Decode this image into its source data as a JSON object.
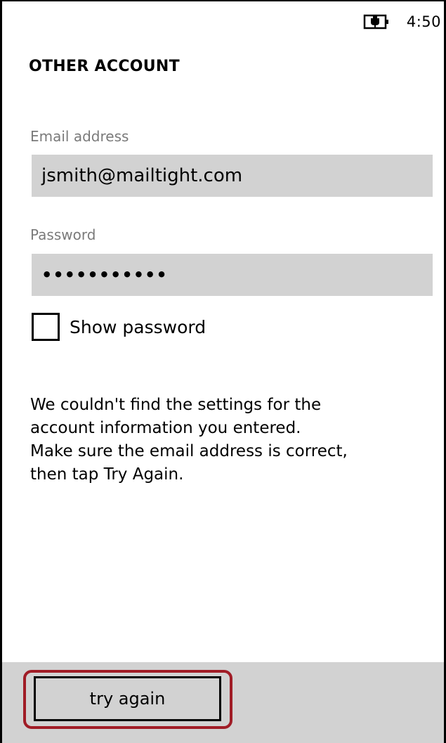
{
  "status_bar": {
    "time": "4:50",
    "battery_icon": "battery-charging-icon"
  },
  "page": {
    "title": "OTHER ACCOUNT"
  },
  "form": {
    "email_label": "Email address",
    "email_value": "jsmith@mailtight.com",
    "password_label": "Password",
    "password_value": "•••••••••••",
    "show_password_label": "Show password",
    "show_password_checked": false
  },
  "message": {
    "lines": [
      "We couldn't find the settings for the",
      "account information you entered.",
      "Make sure the email address is correct,",
      "then tap Try Again."
    ]
  },
  "app_bar": {
    "try_again_label": "try again",
    "highlight_color": "#a01c26"
  }
}
